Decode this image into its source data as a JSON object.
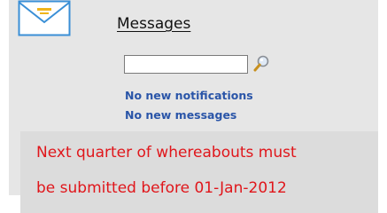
{
  "messages_widget": {
    "icon": "envelope-icon",
    "title": "Messages",
    "search": {
      "value": "",
      "placeholder": "",
      "button_icon": "magnifier-icon"
    },
    "notifications": [
      "No new notifications",
      "No new messages"
    ]
  },
  "alert": {
    "lines": [
      "Next quarter of whereabouts must",
      "be submitted before 01-Jan-2012"
    ],
    "text_color": "#e0161b"
  },
  "colors": {
    "panel_bg": "#e6e6e6",
    "link_blue": "#2a55a8",
    "alert_bg": "#dcdcdc"
  }
}
